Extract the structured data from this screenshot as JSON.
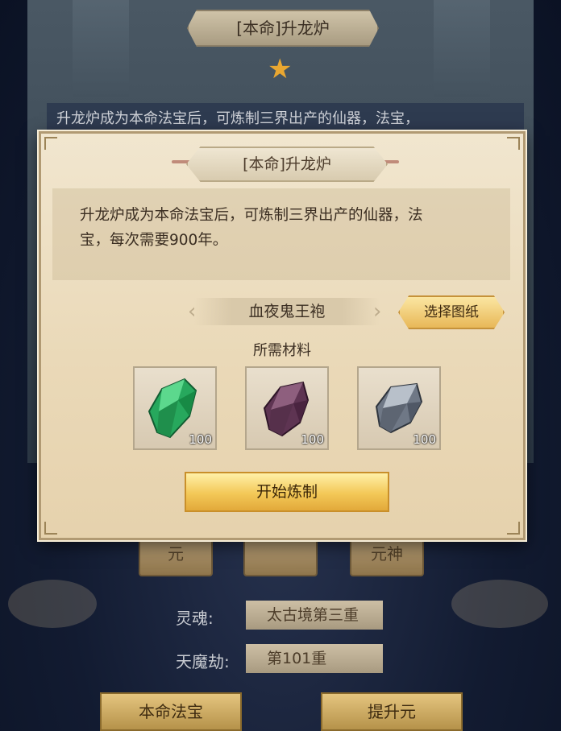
{
  "background": {
    "title": "[本命]升龙炉",
    "desc_partial": "升龙炉成为本命法宝后，可炼制三界出产的仙器，法宝，",
    "slots": [
      "元",
      "",
      "元神"
    ],
    "stats": [
      {
        "label": "灵魂:",
        "value": "太古境第三重"
      },
      {
        "label": "天魔劫:",
        "value": "第101重"
      }
    ],
    "buttons": [
      "本命法宝",
      "提升元"
    ]
  },
  "modal": {
    "title": "[本命]升龙炉",
    "description_line1": "升龙炉成为本命法宝后，可炼制三界出产的仙器，法",
    "description_line2": "宝，每次需要900年。",
    "recipe_name": "血夜鬼王袍",
    "select_button": "选择图纸",
    "materials_label": "所需材料",
    "materials": [
      {
        "icon": "green-crystal-icon",
        "count": "100",
        "color": "#2fb766"
      },
      {
        "icon": "purple-crystal-icon",
        "count": "100",
        "color": "#6b3d5e"
      },
      {
        "icon": "silver-crystal-icon",
        "count": "100",
        "color": "#7c8593"
      }
    ],
    "start_button": "开始炼制"
  }
}
